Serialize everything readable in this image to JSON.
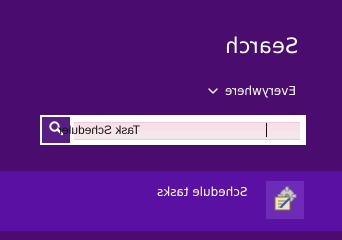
{
  "header": {
    "title": "Search"
  },
  "search": {
    "scope_label": "Everywhere",
    "query": "Task Scheduler",
    "placeholder": ""
  },
  "results": [
    {
      "label": "Schedule tasks",
      "icon": "scheduler-icon"
    }
  ],
  "colors": {
    "background": "#4b0c70",
    "result_highlight": "#5a10a3",
    "search_button": "#5a1c86",
    "text": "#ffffff"
  }
}
